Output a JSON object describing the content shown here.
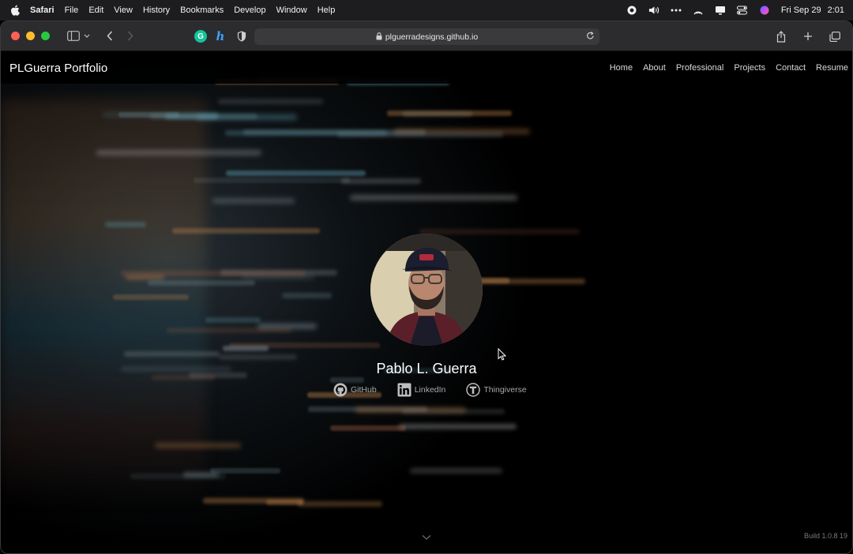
{
  "menubar": {
    "app": "Safari",
    "items": [
      "File",
      "Edit",
      "View",
      "History",
      "Bookmarks",
      "Develop",
      "Window",
      "Help"
    ],
    "date": "Fri Sep 29",
    "time": "2:01"
  },
  "browser": {
    "url": "plguerradesigns.github.io",
    "extension_g": "G",
    "extension_h": "h"
  },
  "site": {
    "brand": "PLGuerra Portfolio",
    "nav": [
      "Home",
      "About",
      "Professional",
      "Projects",
      "Contact",
      "Resume"
    ],
    "name": "Pablo L. Guerra",
    "social": [
      {
        "label": "GitHub",
        "icon": "github-icon"
      },
      {
        "label": "LinkedIn",
        "icon": "linkedin-icon"
      },
      {
        "label": "Thingiverse",
        "icon": "thingiverse-icon"
      }
    ],
    "build": "Build 1.0.8 19"
  },
  "colors": {
    "accent_green": "#15c39a",
    "accent_blue": "#3b9ff6",
    "page_bg": "#000000"
  }
}
